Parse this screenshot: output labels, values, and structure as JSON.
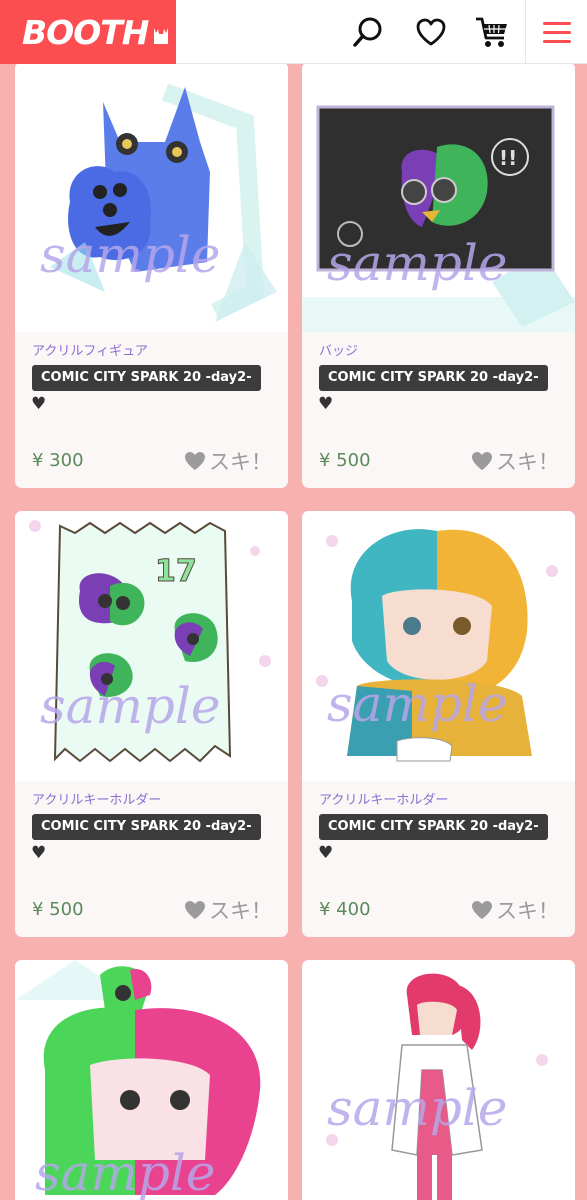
{
  "header": {
    "logo_text": "BOOTH",
    "icons": [
      "search-icon",
      "heart-icon",
      "cart-icon",
      "menu-icon"
    ]
  },
  "colors": {
    "brand": "#fc4d50",
    "page_bg": "#f7b1ae",
    "category": "#8a6fd1",
    "price": "#5b8a5b",
    "event_tag_bg": "#3c3c3c"
  },
  "watermark": "sample",
  "products": [
    {
      "category": "アクリルフィギュア",
      "event": "COMIC CITY SPARK 20 -day2-",
      "mark": "♥",
      "price": "¥ 300",
      "like": "スキ！"
    },
    {
      "category": "バッジ",
      "event": "COMIC CITY SPARK 20 -day2-",
      "mark": "♥",
      "price": "¥ 500",
      "like": "スキ！"
    },
    {
      "category": "アクリルキーホルダー",
      "event": "COMIC CITY SPARK 20 -day2-",
      "mark": "♥",
      "price": "¥ 500",
      "like": "スキ！"
    },
    {
      "category": "アクリルキーホルダー",
      "event": "COMIC CITY SPARK 20 -day2-",
      "mark": "♥",
      "price": "¥ 400",
      "like": "スキ！"
    }
  ]
}
